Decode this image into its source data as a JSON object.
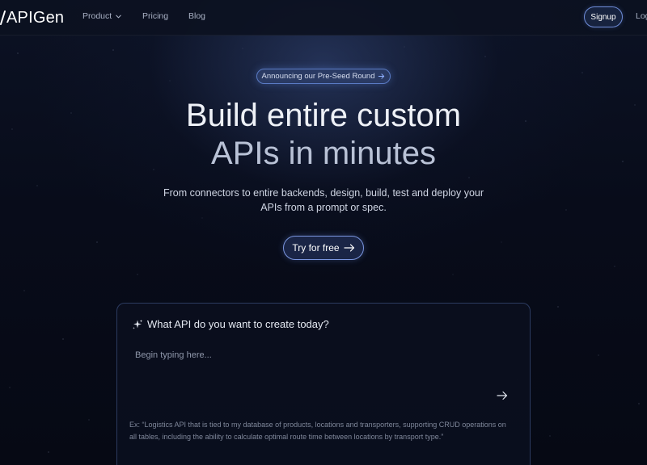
{
  "nav": {
    "logo_text": "APIGen",
    "links": [
      {
        "label": "Product"
      },
      {
        "label": "Pricing"
      },
      {
        "label": "Blog"
      }
    ],
    "signup_label": "Signup",
    "login_label": "Login"
  },
  "hero": {
    "announcement": "Announcing our Pre-Seed Round",
    "title_line1": "Build entire custom",
    "title_line2": "APIs in minutes",
    "subtitle": "From connectors to entire backends, design, build, test and deploy your APIs from a prompt or spec.",
    "cta_label": "Try for free"
  },
  "prompt": {
    "heading": "What API do you want to create today?",
    "placeholder": "Begin typing here...",
    "example": "Ex: “Logistics API that is tied to my database of products, locations and transporters, supporting CRUD operations on all tables, including the ability to calculate optimal route time between locations by transport type.”"
  },
  "colors": {
    "background": "#070b17",
    "accent": "#6f8cd8",
    "announcement_bg": "#2a3a63"
  },
  "icons": {
    "product_menu": "chevron-down-icon",
    "announcement": "arrow-right-icon",
    "cta": "arrow-right-icon",
    "prompt_heading": "sparkle-icon",
    "submit": "arrow-right-icon"
  }
}
